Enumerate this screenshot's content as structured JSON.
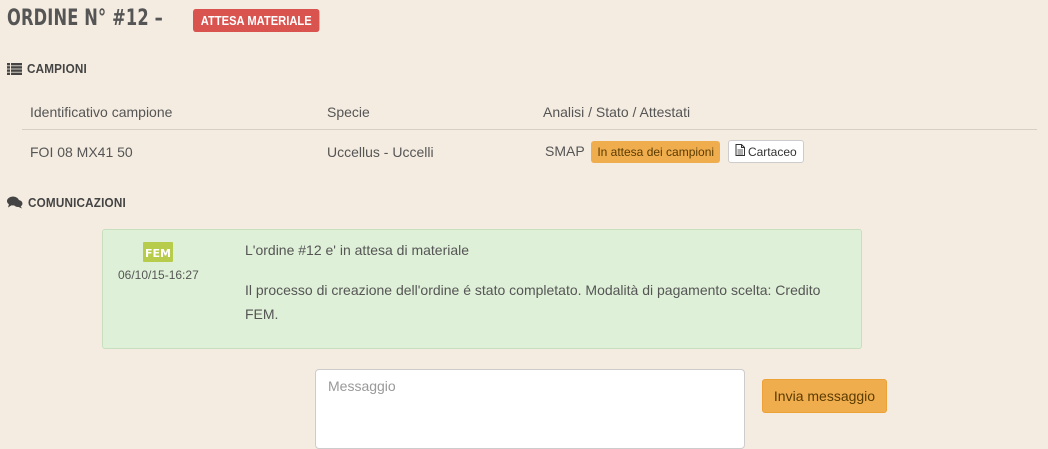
{
  "order": {
    "title": "ORDINE N° #12 –",
    "status": "ATTESA MATERIALE",
    "status_color": "#d9534f"
  },
  "samples_section": {
    "icon": "list-icon",
    "heading": "CAMPIONI",
    "columns": [
      "Identificativo campione",
      "Specie",
      "Analisi / Stato / Attestati"
    ],
    "rows": [
      {
        "id": "FOI 08 MX41 50",
        "species": "Uccellus - Uccelli",
        "analysis": "SMAP",
        "state": "In attesa dei campioni",
        "certificate_icon": "file-icon",
        "certificate": "Cartaceo"
      }
    ]
  },
  "communications_section": {
    "icon": "comments-icon",
    "heading": "COMUNICAZIONI",
    "messages": [
      {
        "logo": "FEM",
        "date": "06/10/15-16:27",
        "subject": "L'ordine #12 e' in attesa di materiale",
        "body": "Il processo di creazione dell'ordine é stato completato. Modalità di pagamento scelta: Credito FEM."
      }
    ]
  },
  "composer": {
    "placeholder": "Messaggio",
    "send_label": "Invia messaggio",
    "button_color": "#f0ad4e"
  }
}
